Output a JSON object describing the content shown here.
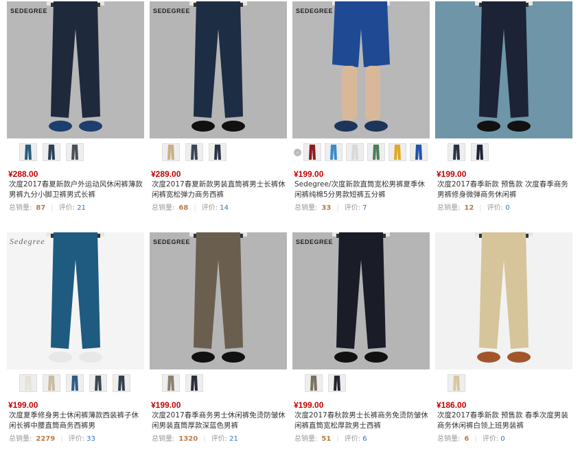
{
  "labels": {
    "sales": "总销量:",
    "reviews": "评价:"
  },
  "products": [
    {
      "brand": "SEDEGREE",
      "price": "¥288.00",
      "title": "次度2017春夏新款户外运动风休闲裤薄款男裤九分小脚卫裤男式长裤",
      "sales": "87",
      "reviews": "21",
      "bg": "#b8b8b8",
      "pants": "#1e2a3c",
      "shoes": "#1d3f6d",
      "thumbs": [
        "#2a5d7a",
        "#2b3f55",
        "#4a4f5a"
      ],
      "arrows": false
    },
    {
      "brand": "SEDEGREE",
      "price": "¥289.00",
      "title": "次度2017春夏新款男装直筒裤男士长裤休闲裤宽松弹力商务西裤",
      "sales": "68",
      "reviews": "14",
      "bg": "#b5b5b5",
      "pants": "#1d2d44",
      "shoes": "#111",
      "thumbs": [
        "#c7b08a",
        "#3d4656",
        "#2a3344"
      ],
      "arrows": false
    },
    {
      "brand": "SEDEGREE",
      "price": "¥199.00",
      "title": "Sedegree/次度新款直筒宽松男裤夏季休闲裤纯棉5分男款短裤五分裤",
      "sales": "33",
      "reviews": "7",
      "bg": "#b8b8b8",
      "pants": "#1f4a93",
      "shoes": "#1c3558",
      "short": true,
      "thumbs": [
        "#8b1c22",
        "#3c8bc7",
        "#d8d8d8",
        "#4e7c5a",
        "#e0a824",
        "#2152a8"
      ],
      "arrows": true
    },
    {
      "brand": "",
      "price": "¥199.00",
      "title": "次度2017春季新款 预售款 次度春季商务男裤修身微弹商务休闲裤",
      "sales": "12",
      "reviews": "0",
      "bg": "#6e95a8",
      "pants": "#1c2336",
      "shoes": "#111",
      "thumbs": [
        "#2b3244",
        "#1e2433"
      ],
      "arrows": false
    },
    {
      "brand": "Sedegree",
      "script": true,
      "price": "¥199.00",
      "title": "次度夏季修身男士休闲裤薄款西装裤子休闲长裤中腰直筒商务西裤男",
      "sales": "2279",
      "reviews": "33",
      "bg": "#f4f4f4",
      "pants": "#1f5a80",
      "shoes": "#e8e8e8",
      "thumbs": [
        "#e6e2d6",
        "#cbbba0",
        "#2e5c84",
        "#3f4650",
        "#33404c"
      ],
      "arrows": false
    },
    {
      "brand": "SEDEGREE",
      "price": "¥199.00",
      "title": "次度2017春季商务男士休闲裤免烫防皱休闲男装直筒厚款深蓝色男裤",
      "sales": "1320",
      "reviews": "21",
      "bg": "#b5b5b5",
      "pants": "#6a5f4e",
      "shoes": "#111",
      "thumbs": [
        "#8a806e",
        "#2b2f38"
      ],
      "arrows": false
    },
    {
      "brand": "SEDEGREE",
      "price": "¥199.00",
      "title": "次度2017春秋款男士长裤商务免烫防皱休闲裤直筒宽松厚款男士西裤",
      "sales": "51",
      "reviews": "6",
      "bg": "#b5b5b5",
      "pants": "#1a1d28",
      "shoes": "#111",
      "thumbs": [
        "#7b7160",
        "#22252e"
      ],
      "arrows": false
    },
    {
      "brand": "",
      "price": "¥186.00",
      "title": "次度2017春季新款 预售款 春季次度男装商务休闲裤白领上班男装裤",
      "sales": "6",
      "reviews": "0",
      "bg": "#f2f2f2",
      "pants": "#d6c59a",
      "shoes": "#a0562a",
      "thumbs": [
        "#d8c7a0"
      ],
      "arrows": false
    }
  ]
}
